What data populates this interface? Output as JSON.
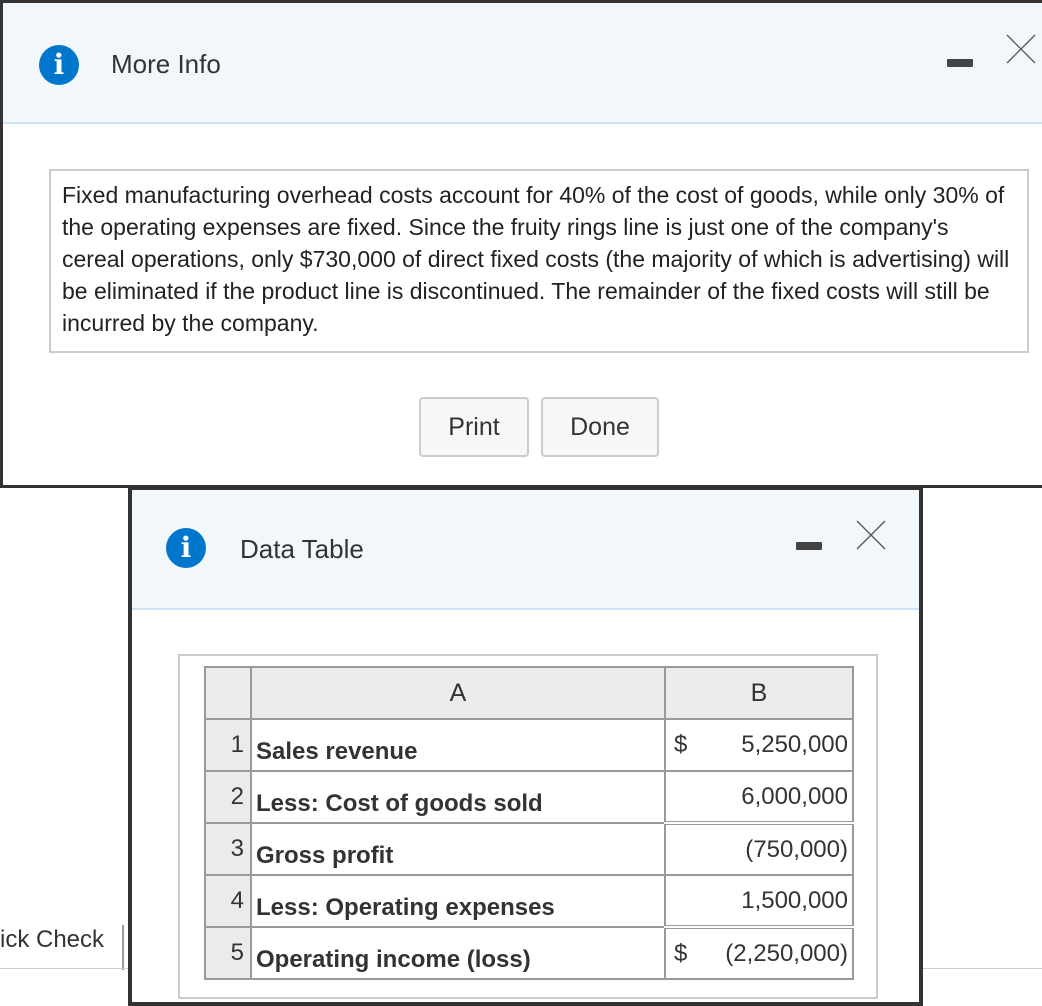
{
  "background": {
    "partial_text": "ick Check"
  },
  "more_info": {
    "title": "More Info",
    "icon": "info-icon",
    "message": "Fixed manufacturing overhead costs account for 40% of the cost of goods, while only 30% of the operating expenses are fixed. Since the fruity rings line is just one of the company's cereal operations, only $730,000 of direct fixed costs (the majority of which is advertising) will be eliminated if the product line is discontinued. The remainder of the fixed costs will still be incurred by the company.",
    "print_label": "Print",
    "done_label": "Done"
  },
  "data_table": {
    "title": "Data Table",
    "icon": "info-icon",
    "columns": [
      "A",
      "B"
    ],
    "rows": [
      {
        "num": "1",
        "label": "Sales revenue",
        "currency": "$",
        "value": "5,250,000"
      },
      {
        "num": "2",
        "label": "Less: Cost of goods sold",
        "currency": "",
        "value": "6,000,000"
      },
      {
        "num": "3",
        "label": "Gross profit",
        "currency": "",
        "value": "(750,000)"
      },
      {
        "num": "4",
        "label": "Less: Operating expenses",
        "currency": "",
        "value": "1,500,000"
      },
      {
        "num": "5",
        "label": "Operating income (loss)",
        "currency": "$",
        "value": "(2,250,000)"
      }
    ]
  },
  "colors": {
    "accent": "#0077cc",
    "header_bg": "#f2f7fb"
  }
}
